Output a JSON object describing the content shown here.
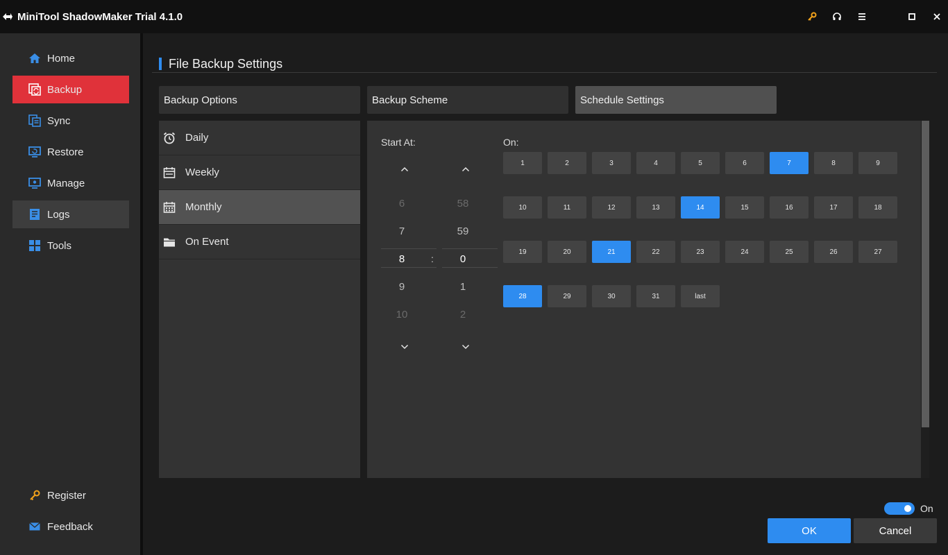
{
  "app": {
    "title": "MiniTool ShadowMaker Trial 4.1.0"
  },
  "colors": {
    "accent": "#2e8cf0",
    "active_nav": "#e0323a",
    "key_icon": "#f2a21b"
  },
  "titlebar_icons": [
    "key-icon",
    "headphones-icon",
    "menu-icon",
    "maximize-icon",
    "close-icon"
  ],
  "sidebar": {
    "items": [
      {
        "label": "Home",
        "icon": "home-icon"
      },
      {
        "label": "Backup",
        "icon": "backup-icon"
      },
      {
        "label": "Sync",
        "icon": "sync-icon"
      },
      {
        "label": "Restore",
        "icon": "restore-icon"
      },
      {
        "label": "Manage",
        "icon": "manage-icon"
      },
      {
        "label": "Logs",
        "icon": "logs-icon"
      },
      {
        "label": "Tools",
        "icon": "tools-icon"
      }
    ],
    "bottom": [
      {
        "label": "Register",
        "icon": "key-icon"
      },
      {
        "label": "Feedback",
        "icon": "mail-icon"
      }
    ]
  },
  "page": {
    "title": "File Backup Settings",
    "tabs": [
      "Backup Options",
      "Backup Scheme",
      "Schedule Settings"
    ],
    "selected_tab": "Schedule Settings"
  },
  "schedule": {
    "types": [
      {
        "label": "Daily",
        "icon": "alarm-clock-icon"
      },
      {
        "label": "Weekly",
        "icon": "calendar-week-icon"
      },
      {
        "label": "Monthly",
        "icon": "calendar-month-icon"
      },
      {
        "label": "On Event",
        "icon": "folder-icon"
      }
    ],
    "selected_type": "Monthly",
    "start_label": "Start At:",
    "on_label": "On:",
    "hour_values": [
      "6",
      "7",
      "8",
      "9",
      "10"
    ],
    "minute_values": [
      "58",
      "59",
      "0",
      "1",
      "2"
    ],
    "separator": ":",
    "days": [
      "1",
      "2",
      "3",
      "4",
      "5",
      "6",
      "7",
      "8",
      "9",
      "10",
      "11",
      "12",
      "13",
      "14",
      "15",
      "16",
      "17",
      "18",
      "19",
      "20",
      "21",
      "22",
      "23",
      "24",
      "25",
      "26",
      "27",
      "28",
      "29",
      "30",
      "31",
      "last"
    ],
    "selected_days": [
      "7",
      "14",
      "21",
      "28"
    ]
  },
  "footer": {
    "toggle_label": "On",
    "ok_label": "OK",
    "cancel_label": "Cancel"
  }
}
